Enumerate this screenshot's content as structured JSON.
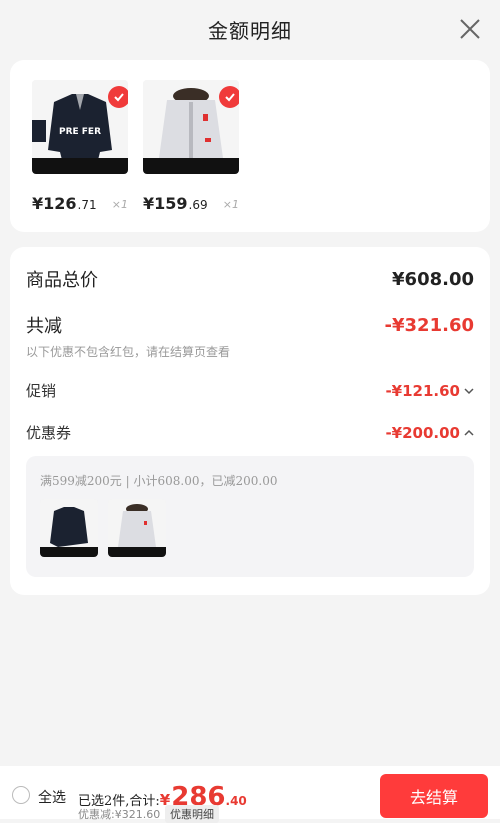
{
  "header": {
    "title": "金额明细"
  },
  "products": [
    {
      "price_int": "¥126",
      "price_dec": ".71",
      "qty": "×1"
    },
    {
      "price_int": "¥159",
      "price_dec": ".69",
      "qty": "×1"
    }
  ],
  "detail": {
    "total_label": "商品总价",
    "total_value": "¥608.00",
    "discount_label": "共减",
    "discount_value": "-¥321.60",
    "discount_note": "以下优惠不包含红包，请在结算页查看",
    "promo_label": "促销",
    "promo_value": "-¥121.60",
    "coupon_label": "优惠券",
    "coupon_value": "-¥200.00",
    "coupon_desc": "满599减200元 | 小计608.00，已减200.00"
  },
  "bottom": {
    "select_all": "全选",
    "summary": "已选2件,合计:",
    "total_symbol": "¥",
    "total_int": "286",
    "total_dec": ".40",
    "saved": "优惠减:¥321.60",
    "detail_tag": "优惠明细",
    "checkout": "去结算"
  },
  "colors": {
    "accent": "#e83a32",
    "checkout_bg": "#ff3b3b"
  }
}
